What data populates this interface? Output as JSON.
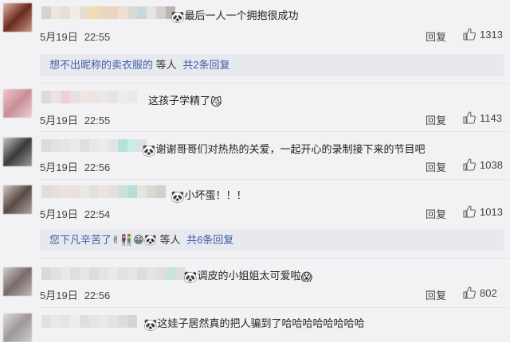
{
  "comments": [
    {
      "text": "最后一人一个拥抱很成功",
      "emoji": "🐼",
      "date": "5月19日",
      "time": "22:55",
      "reply_label": "回复",
      "likes": "1313"
    },
    {
      "text": "这孩子学精了",
      "emoji": "😼",
      "date": "5月19日",
      "time": "22:55",
      "reply_label": "回复",
      "likes": "1143"
    },
    {
      "text": "谢谢哥哥们对热热的关爱，一起开心的录制接下来的节目吧",
      "emoji": "🐼",
      "date": "5月19日",
      "time": "22:56",
      "reply_label": "回复",
      "likes": "1038"
    },
    {
      "text": "小坏蛋！！！",
      "emoji": "🐼",
      "date": "5月19日",
      "time": "22:54",
      "reply_label": "回复",
      "likes": "1013"
    },
    {
      "text": "调皮的小姐姐太可爱啦",
      "emoji": "🐼",
      "emoji_after": "😱",
      "date": "5月19日",
      "time": "22:56",
      "reply_label": "回复",
      "likes": "802"
    },
    {
      "text": "这娃子居然真的把人骗到了哈哈哈哈哈哈哈哈",
      "emoji": "🐼"
    }
  ],
  "subreplies": [
    {
      "link": "想不出昵称的卖衣服的",
      "middle": " 等人 ",
      "count": "共2条回复"
    },
    {
      "link": "您下凡辛苦了",
      "emojis": "✌👫😁🐼",
      "middle": " 等人 ",
      "count": "共6条回复"
    }
  ],
  "colors": {
    "background": "#f2f2f5",
    "link": "#3b5ea8",
    "subreply_bg": "#e8e9ee"
  },
  "icons": {
    "like": "thumbs-up-icon"
  }
}
